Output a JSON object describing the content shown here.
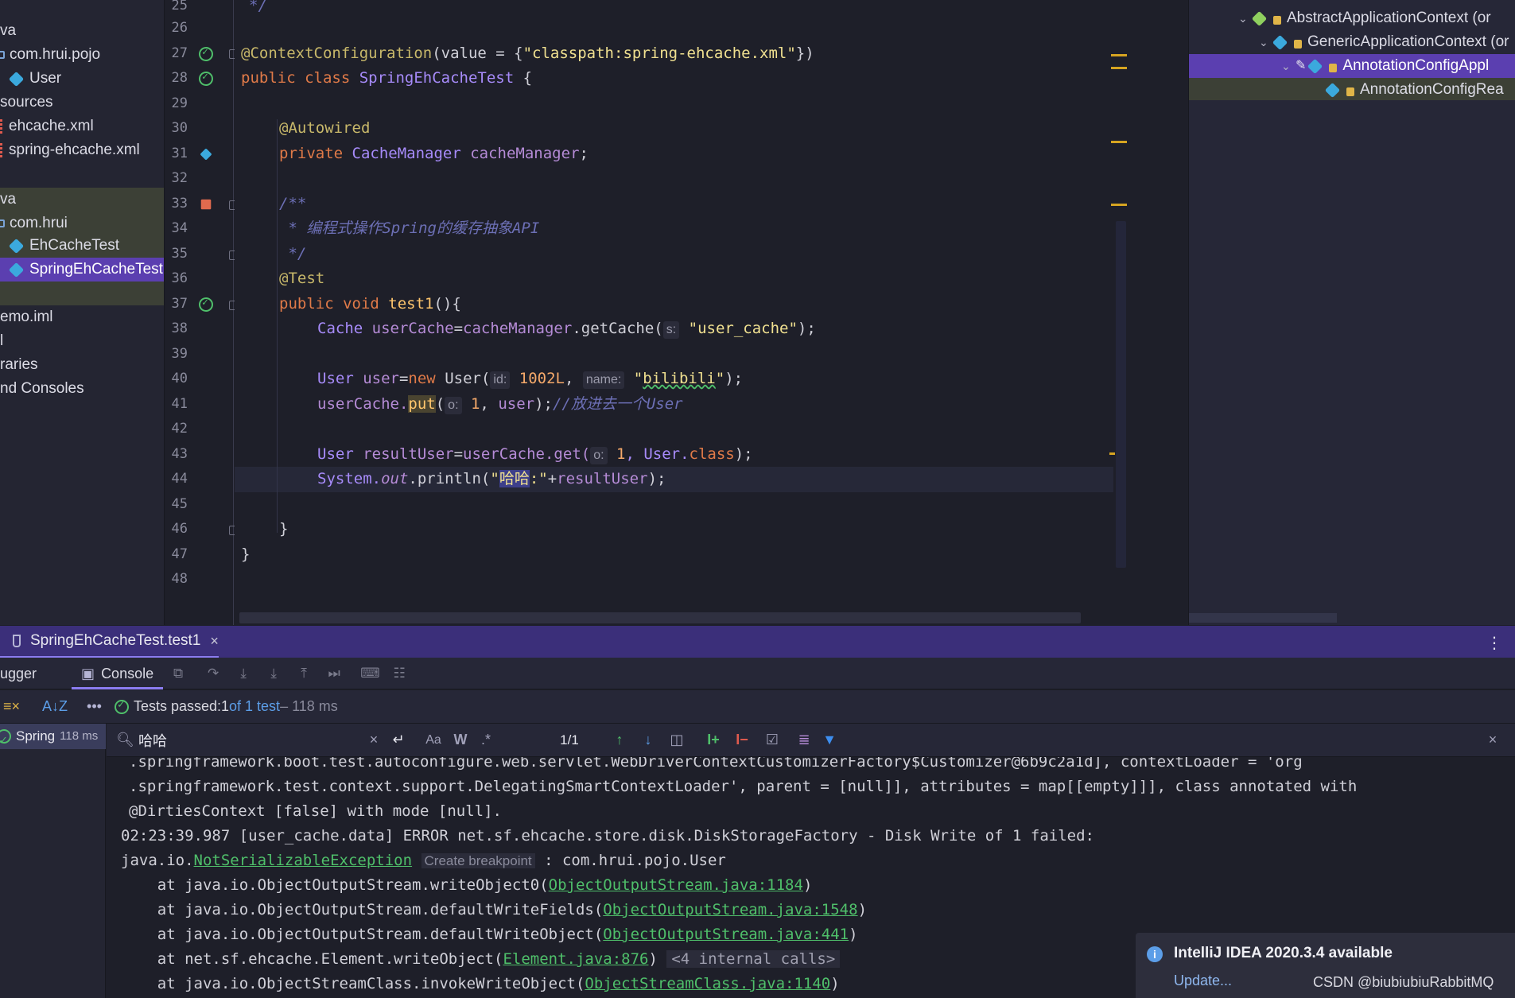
{
  "project_tree": [
    {
      "label": "va",
      "icon": ""
    },
    {
      "label": "com.hrui.pojo",
      "icon": "folder"
    },
    {
      "label": "User",
      "icon": "class"
    },
    {
      "label": "sources",
      "icon": ""
    },
    {
      "label": "ehcache.xml",
      "icon": "xml"
    },
    {
      "label": "spring-ehcache.xml",
      "icon": "xml"
    },
    {
      "label": "va",
      "icon": ""
    },
    {
      "label": "com.hrui",
      "icon": "folder"
    },
    {
      "label": "EhCacheTest",
      "icon": "class"
    },
    {
      "label": "SpringEhCacheTest",
      "icon": "class"
    },
    {
      "label": "emo.iml",
      "icon": ""
    },
    {
      "label": "l",
      "icon": ""
    },
    {
      "label": "raries",
      "icon": ""
    },
    {
      "label": "nd Consoles",
      "icon": ""
    }
  ],
  "editor": {
    "line_numbers": [
      "25",
      "26",
      "27",
      "28",
      "29",
      "30",
      "31",
      "32",
      "33",
      "34",
      "35",
      "36",
      "37",
      "38",
      "39",
      "40",
      "41",
      "42",
      "43",
      "44",
      "45",
      "46",
      "47",
      "48"
    ],
    "code": {
      "l25": "*/",
      "l27_ann": "@ContextConfiguration",
      "l27_rest": "(value = {",
      "l27_str": "\"classpath:spring-ehcache.xml\"",
      "l27_end": "})",
      "l28_kw": "public class ",
      "l28_cls": "SpringEhCacheTest",
      "l28_end": " {",
      "l30_ann": "@Autowired",
      "l31_kw": "private ",
      "l31_cls": "CacheManager ",
      "l31_fld": "cacheManager",
      "l31_end": ";",
      "l33": "/**",
      "l34": " * 编程式操作Spring的缓存抽象API",
      "l35": " */",
      "l36_ann": "@Test",
      "l37_kw": "public void ",
      "l37_fn": "test1",
      "l37_end": "(){",
      "l38_a": "Cache ",
      "l38_b": "userCache",
      "l38_c": "=",
      "l38_d": "cacheManager",
      "l38_e": ".getCache(",
      "l38_hint": "s:",
      "l38_str": "\"user_cache\"",
      "l38_end": ");",
      "l40_a": "User ",
      "l40_b": "user",
      "l40_c": "=",
      "l40_kw": "new ",
      "l40_d": "User(",
      "l40_hint1": "id:",
      "l40_num": "1002L",
      "l40_comma": ", ",
      "l40_hint2": "name:",
      "l40_str1": "\"",
      "l40_str2": "bilibili",
      "l40_str3": "\"",
      "l40_end": ");",
      "l41_a": "userCache.",
      "l41_put": "put",
      "l41_b": "(",
      "l41_hint": "o:",
      "l41_num": "1",
      "l41_c": ", ",
      "l41_d": "user",
      "l41_e": ");",
      "l41_cmt": "//放进去一个User",
      "l43_a": "User ",
      "l43_b": "resultUser",
      "l43_c": "=",
      "l43_d": "userCache.get(",
      "l43_hint": "o:",
      "l43_num": "1",
      "l43_e": ", User.",
      "l43_kw": "class",
      "l43_end": ");",
      "l44_a": "System.",
      "l44_out": "out",
      "l44_b": ".println(",
      "l44_s1": "\"",
      "l44_s2": "哈哈",
      "l44_s3": ":\"",
      "l44_c": "+",
      "l44_d": "resultUser",
      "l44_end": ");",
      "l46": "}",
      "l47": "}"
    }
  },
  "hierarchy": [
    {
      "label": "AbstractApplicationContext (or",
      "indent": 1
    },
    {
      "label": "GenericApplicationContext (or",
      "indent": 2
    },
    {
      "label": "AnnotationConfigAppl",
      "indent": 3
    },
    {
      "label": "AnnotationConfigRea",
      "indent": 4
    }
  ],
  "run_panel": {
    "tab_label": "SpringEhCacheTest.test1",
    "debugger_label": "ugger",
    "console_label": "Console",
    "status_passed": "Tests passed: ",
    "status_count": "1",
    "status_of": " of 1 test",
    "status_time": " – 118 ms",
    "tree_node": "Spring",
    "tree_time": "118 ms"
  },
  "search": {
    "query": "哈哈",
    "match_count": "1/1",
    "case_label": "Aa",
    "word_label": "W",
    "regex_label": ".*"
  },
  "console_lines": {
    "c0": ".springframework.boot.test.autoconfigure.web.servlet.WebDriverContextCustomizerFactory$Customizer@6b9c2a1d], contextLoader = 'org",
    "c1": ".springframework.test.context.support.DelegatingSmartContextLoader', parent = [null]], attributes = map[[empty]]], class annotated with",
    "c2": "@DirtiesContext [false] with mode [null].",
    "c3": "02:23:39.987 [user_cache.data] ERROR net.sf.ehcache.store.disk.DiskStorageFactory - Disk Write of 1 failed:",
    "c4_a": "java.io.",
    "c4_link": "NotSerializableException",
    "c4_hint": "Create breakpoint",
    "c4_b": " : com.hrui.pojo.User",
    "c5_a": "    at java.io.ObjectOutputStream.writeObject0(",
    "c5_link": "ObjectOutputStream.java:1184",
    "c5_b": ")",
    "c6_a": "    at java.io.ObjectOutputStream.defaultWriteFields(",
    "c6_link": "ObjectOutputStream.java:1548",
    "c6_b": ")",
    "c7_a": "    at java.io.ObjectOutputStream.defaultWriteObject(",
    "c7_link": "ObjectOutputStream.java:441",
    "c7_b": ")",
    "c8_a": "    at net.sf.ehcache.Element.writeObject(",
    "c8_link": "Element.java:876",
    "c8_b": ") ",
    "c8_int": "<4 internal calls>",
    "c9_a": "    at java.io.ObjectStreamClass.invokeWriteObject(",
    "c9_link": "ObjectStreamClass.java:1140",
    "c9_b": ")"
  },
  "notification": {
    "title": "IntelliJ IDEA 2020.3.4 available",
    "action": "Update..."
  },
  "watermark": "CSDN @biubiubiuRabbitMQ",
  "colors": {
    "accent": "#5b3fb0",
    "keyword": "#e07a48",
    "string": "#f0e090",
    "link": "#4fbf6a"
  }
}
